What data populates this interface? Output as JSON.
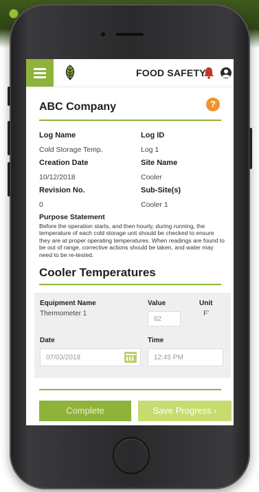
{
  "header": {
    "app_title": "FOOD SAFETY",
    "icons": {
      "menu": "hamburger-menu-icon",
      "logo": "leaf-logo-icon",
      "bell": "bell-icon",
      "user": "user-icon"
    }
  },
  "company": {
    "name": "ABC Company",
    "help_icon": "?"
  },
  "fields": [
    {
      "label": "Log Name",
      "value": "Cold Storage Temp.",
      "label2": "Log ID",
      "value2": "Log 1"
    },
    {
      "label": "Creation Date",
      "value": "10/12/2018",
      "label2": "Site Name",
      "value2": "Cooler"
    },
    {
      "label": "Revision No.",
      "value": "0",
      "label2": "Sub-Site(s)",
      "value2": "Cooler 1"
    }
  ],
  "purpose": {
    "label": "Purpose Statement",
    "text": "Before the operation starts, and then hourly, during running, the temperature of each cold storage unit should be checked to ensure they are at proper operating temperatures. When readings are found to be out of range, corrective actions should be taken, and water may need to be re-tested."
  },
  "section": {
    "title": "Cooler Temperatures",
    "equipment_label": "Equipment Name",
    "equipment_value": "Thermometer 1",
    "value_label": "Value",
    "value_input": "62",
    "unit_label": "Unit",
    "unit_value": "F'",
    "date_label": "Date",
    "date_value": "07/03/2018",
    "time_label": "Time",
    "time_value": "12:45 PM"
  },
  "actions": {
    "complete": "Complete",
    "save": "Save Progress ›"
  },
  "colors": {
    "accent": "#8fb33a",
    "accent_light": "#c6dc6e",
    "help": "#f0932b",
    "bell": "#c0392b"
  }
}
